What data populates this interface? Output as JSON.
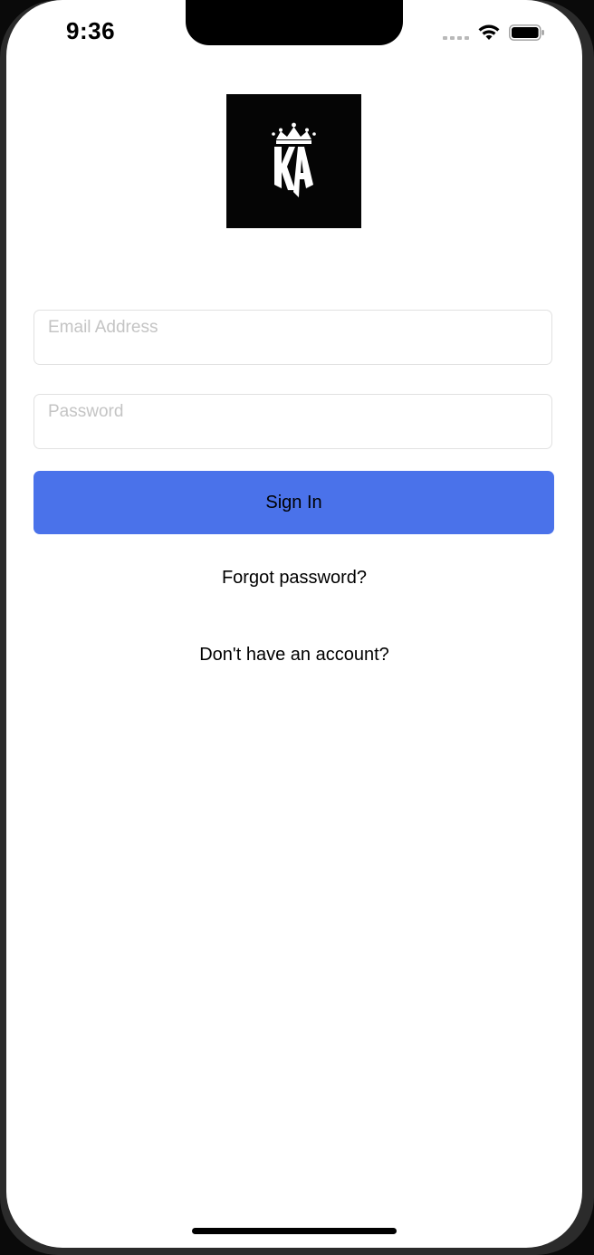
{
  "status_bar": {
    "time": "9:36",
    "icons": [
      "signal-dots-icon",
      "wifi-icon",
      "battery-icon"
    ]
  },
  "logo": {
    "name": "ka-crown-logo",
    "background": "#050505",
    "foreground": "#ffffff"
  },
  "form": {
    "email": {
      "value": "",
      "placeholder": "Email Address"
    },
    "password": {
      "value": "",
      "placeholder": "Password"
    },
    "sign_in_label": "Sign In",
    "forgot_password_label": "Forgot password?",
    "sign_up_label": "Don't have an account?"
  },
  "colors": {
    "accent": "#4a72ea",
    "placeholder": "#c4c4c4",
    "field_border": "#e1e1e1"
  }
}
